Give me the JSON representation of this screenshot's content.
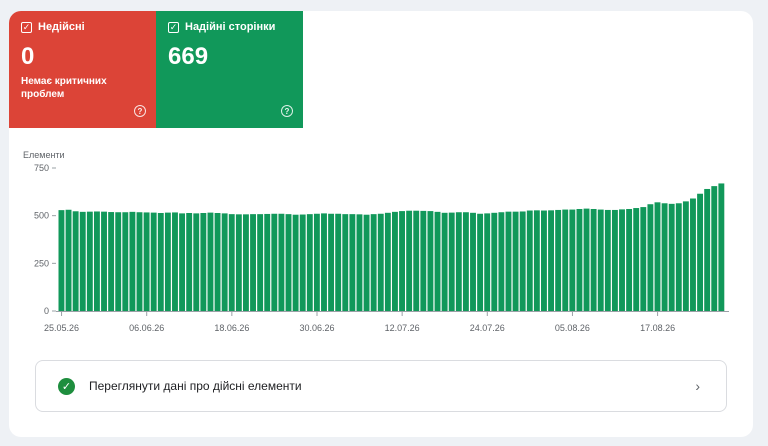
{
  "tiles": [
    {
      "label": "Недійсні",
      "count": "0",
      "sub": "Немає критичних проблем",
      "help": "?"
    },
    {
      "label": "Надійні сторінки",
      "count": "669",
      "help": "?"
    }
  ],
  "chart_label": "Елементи",
  "chart_data": {
    "type": "bar",
    "ylabel": "Елементи",
    "ylim": [
      0,
      750
    ],
    "yticks": [
      0,
      250,
      500,
      750
    ],
    "xticks": [
      "25.05.26",
      "06.06.26",
      "18.06.26",
      "30.06.26",
      "12.07.26",
      "24.07.26",
      "05.08.26",
      "17.08.26"
    ],
    "color": "#11985a",
    "values": [
      529,
      531,
      523,
      520,
      521,
      522,
      521,
      519,
      518,
      518,
      520,
      518,
      517,
      516,
      514,
      516,
      517,
      512,
      514,
      512,
      514,
      516,
      514,
      512,
      508,
      507,
      507,
      508,
      508,
      509,
      510,
      510,
      508,
      505,
      506,
      508,
      510,
      512,
      510,
      510,
      508,
      508,
      507,
      505,
      508,
      510,
      515,
      520,
      524,
      526,
      526,
      525,
      524,
      520,
      515,
      516,
      518,
      518,
      515,
      510,
      512,
      515,
      518,
      521,
      521,
      522,
      527,
      528,
      527,
      528,
      530,
      532,
      532,
      535,
      537,
      535,
      532,
      530,
      530,
      533,
      535,
      540,
      545,
      560,
      570,
      565,
      562,
      565,
      575,
      590,
      615,
      640,
      655,
      669
    ]
  },
  "info_row": {
    "label": "Переглянути дані про дійсні елементи",
    "icon": "check-circle-icon"
  },
  "colors": {
    "invalid": "#dc4437",
    "valid": "#11985a"
  }
}
